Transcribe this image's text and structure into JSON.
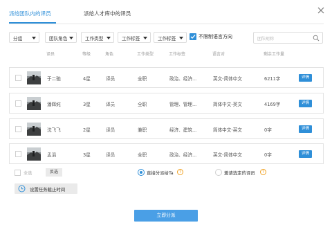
{
  "tabs": [
    {
      "label": "派给团队内的译员",
      "active": true
    },
    {
      "label": "派给人才库中的译员",
      "active": false
    }
  ],
  "filters": {
    "group": "分组",
    "team_role": "团队角色",
    "work_type": "工作类型",
    "work_tag": "工作标签",
    "work_tag2": "工作标签",
    "restrict_lang_label": "不限制语言方向",
    "restrict_lang_checked": true,
    "search_placeholder": "团队昵称"
  },
  "columns": {
    "translator": "译员",
    "level": "等级",
    "role": "角色",
    "work_type": "工作类型",
    "work_tag": "工作标签",
    "lang_pair": "语言对",
    "remaining": "剩余工作量"
  },
  "rows": [
    {
      "name": "于二驰",
      "level": "4星",
      "role": "译员",
      "work_type": "全职",
      "tags": "政治、经济...",
      "lang": "英文-简体中文",
      "remaining": "6211字",
      "detail": "详情"
    },
    {
      "name": "潘辉姹",
      "level": "3星",
      "role": "译员",
      "work_type": "全职",
      "tags": "管理、管理...",
      "lang": "简体中文-英文",
      "remaining": "4169字",
      "detail": "详情"
    },
    {
      "name": "沈飞飞",
      "level": "2星",
      "role": "译员",
      "work_type": "兼职",
      "tags": "经济、建筑...",
      "lang": "简体中文-英文",
      "remaining": "0字",
      "detail": "详情"
    },
    {
      "name": "孟涓",
      "level": "3星",
      "role": "译员",
      "work_type": "全职",
      "tags": "政治、经济...",
      "lang": "英文-简体中文",
      "remaining": "0字",
      "detail": "详情"
    }
  ],
  "bottom": {
    "select_all": "全选",
    "invert": "反选",
    "direct_assign": "直接分派给Ta",
    "direct_assign_selected": true,
    "invite": "邀请选定的译员",
    "invite_selected": false
  },
  "deadline_label": "设置任务截止时间",
  "submit_label": "立即分派",
  "colors": {
    "accent": "#2f8fd8",
    "warn": "#f0a020"
  }
}
